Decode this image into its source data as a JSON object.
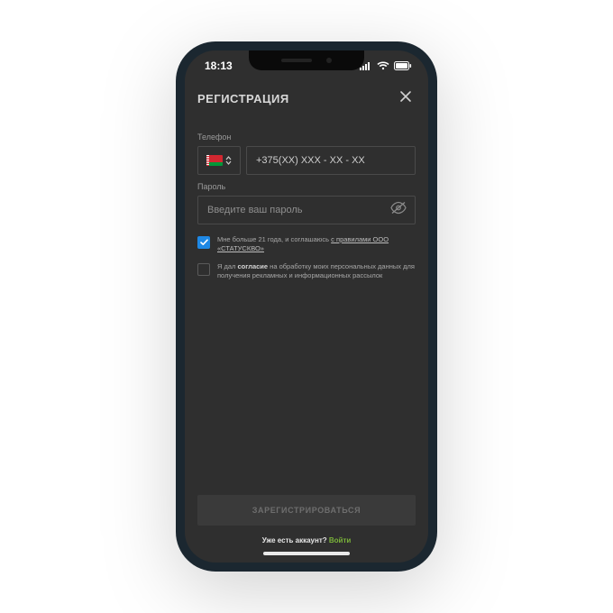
{
  "status": {
    "time": "18:13"
  },
  "header": {
    "title": "РЕГИСТРАЦИЯ"
  },
  "form": {
    "phone": {
      "label": "Телефон",
      "placeholder": "+375(XX) XXX - XX - XX",
      "country_code_icon": "belarus-flag"
    },
    "password": {
      "label": "Пароль",
      "placeholder": "Введите ваш пароль"
    },
    "agree_rules": {
      "checked": true,
      "text_prefix": "Мне больше 21 года, и соглашаюсь ",
      "link_text": "с правилами ООО «СТАТУСКВО»"
    },
    "agree_marketing": {
      "checked": false,
      "text_prefix": "Я дал ",
      "bold_word": "согласие",
      "text_suffix": " на обработку моих персональных данных для получения рекламных и информационных рассылок"
    }
  },
  "actions": {
    "submit_label": "ЗАРЕГИСТРИРОВАТЬСЯ",
    "have_account_text": "Уже есть аккаунт? ",
    "login_link": "Войти"
  }
}
